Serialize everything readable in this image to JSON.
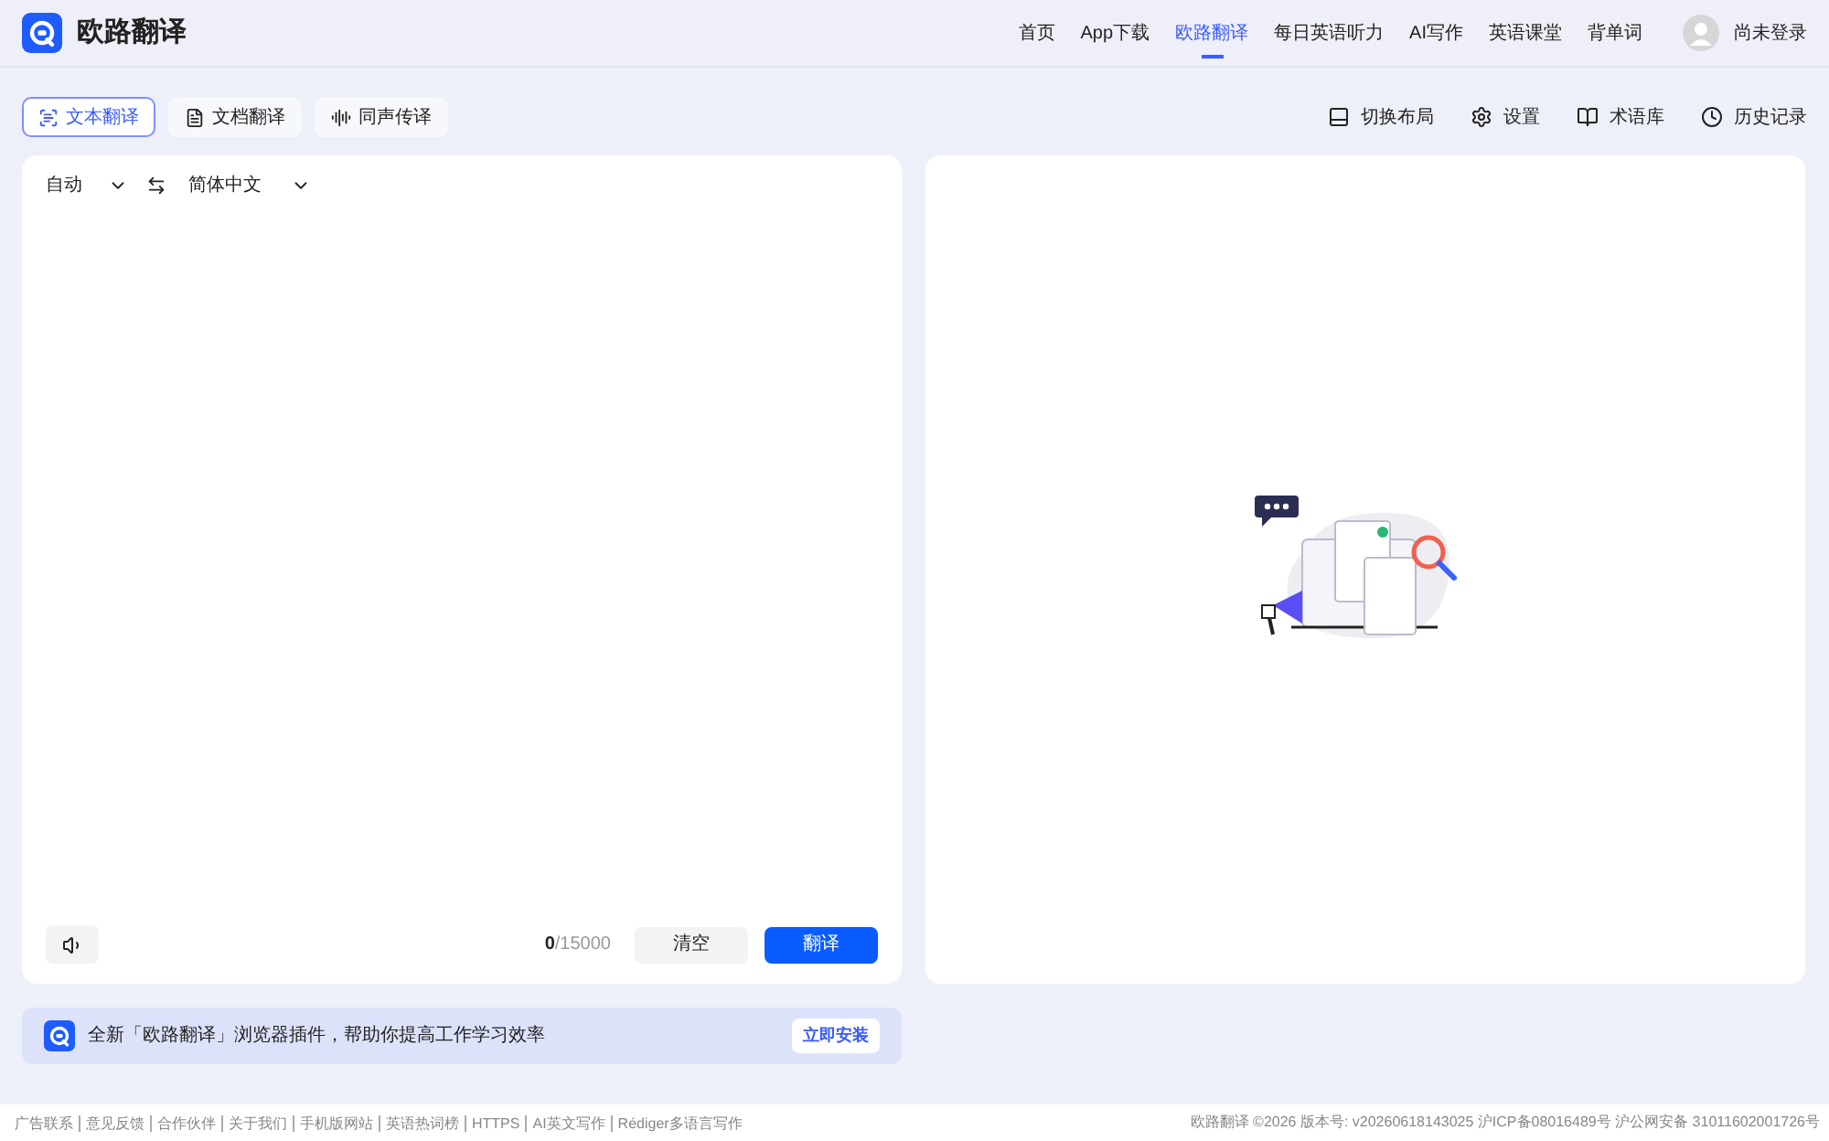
{
  "brand": "欧路翻译",
  "nav": [
    {
      "label": "首页",
      "selected": false
    },
    {
      "label": "App下载",
      "selected": false
    },
    {
      "label": "欧路翻译",
      "selected": true
    },
    {
      "label": "每日英语听力",
      "selected": false
    },
    {
      "label": "AI写作",
      "selected": false
    },
    {
      "label": "英语课堂",
      "selected": false
    },
    {
      "label": "背单词",
      "selected": false
    }
  ],
  "user": "尚未登录",
  "modes": [
    {
      "label": "文本翻译",
      "kind": "text",
      "selected": true
    },
    {
      "label": "文档翻译",
      "kind": "doc",
      "selected": false
    },
    {
      "label": "同声传译",
      "kind": "voice",
      "selected": false
    }
  ],
  "tools": [
    {
      "label": "切换布局",
      "kind": "layout"
    },
    {
      "label": "设置",
      "kind": "settings"
    },
    {
      "label": "术语库",
      "kind": "book"
    },
    {
      "label": "历史记录",
      "kind": "history"
    }
  ],
  "source_lang": "自动",
  "target_lang": "简体中文",
  "char_count": "0",
  "char_limit": "/15000",
  "clear_button": "清空",
  "translate_button": "翻译",
  "banner": {
    "text": "全新「欧路翻译」浏览器插件，帮助你提高工作学习效率",
    "button": "立即安装"
  },
  "footer_links": [
    "广告联系",
    "意见反馈",
    "合作伙伴",
    "关于我们",
    "手机版网站",
    "英语热词榜",
    "HTTPS",
    "AI英文写作",
    "Rédiger多语言写作"
  ],
  "footer_info": "欧路翻译 ©2026 版本号: v20260618143025 沪ICP备08016489号 沪公网安备 31011602001726号"
}
